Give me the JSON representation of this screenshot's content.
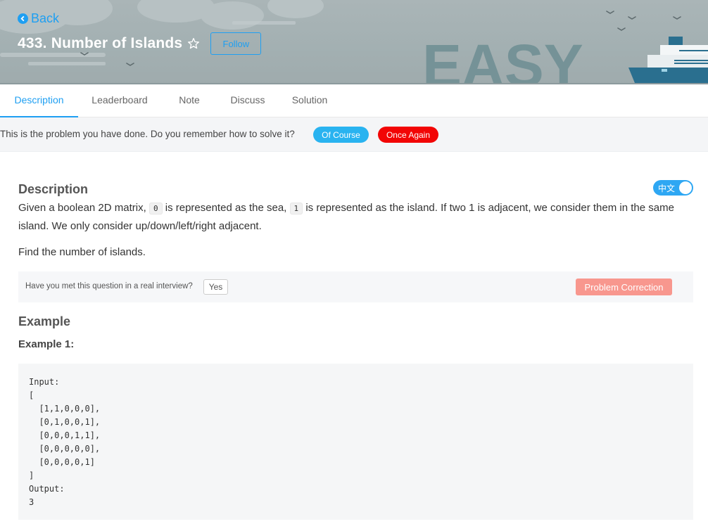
{
  "header": {
    "back_label": "Back",
    "problem_title": "433. Number of Islands",
    "follow_label": "Follow",
    "difficulty_art": "EASY"
  },
  "tabs": [
    {
      "label": "Description",
      "active": true
    },
    {
      "label": "Leaderboard",
      "active": false
    },
    {
      "label": "Note",
      "active": false
    },
    {
      "label": "Discuss",
      "active": false
    },
    {
      "label": "Solution",
      "active": false
    }
  ],
  "notice": {
    "text": "This is the problem you have done. Do you remember how to solve it?",
    "of_course_label": "Of Course",
    "once_again_label": "Once Again"
  },
  "description": {
    "heading": "Description",
    "lang_toggle_label": "中文",
    "para1": {
      "part1": "Given a boolean 2D matrix,",
      "code1": "0",
      "part2": "is represented as the sea,",
      "code2": "1",
      "part3": "is represented as the island. If two 1 is adjacent, we consider them in the same island. We only consider up/down/left/right adjacent."
    },
    "para2": "Find the number of islands."
  },
  "interview": {
    "question": "Have you met this question in a real interview?",
    "yes_label": "Yes",
    "correction_label": "Problem Correction"
  },
  "example": {
    "heading": "Example",
    "sub_heading": "Example 1:",
    "code": "Input:\n[\n  [1,1,0,0,0],\n  [0,1,0,0,1],\n  [0,0,0,1,1],\n  [0,0,0,0,0],\n  [0,0,0,0,1]\n]\nOutput:\n3"
  },
  "colors": {
    "accent": "#1e9ff2",
    "of_course": "#29b3f0",
    "once_again": "#f20505",
    "correction": "#f8978e"
  },
  "icons": [
    "arrow-left-circle-icon",
    "star-outline-icon",
    "ship-illustration"
  ]
}
